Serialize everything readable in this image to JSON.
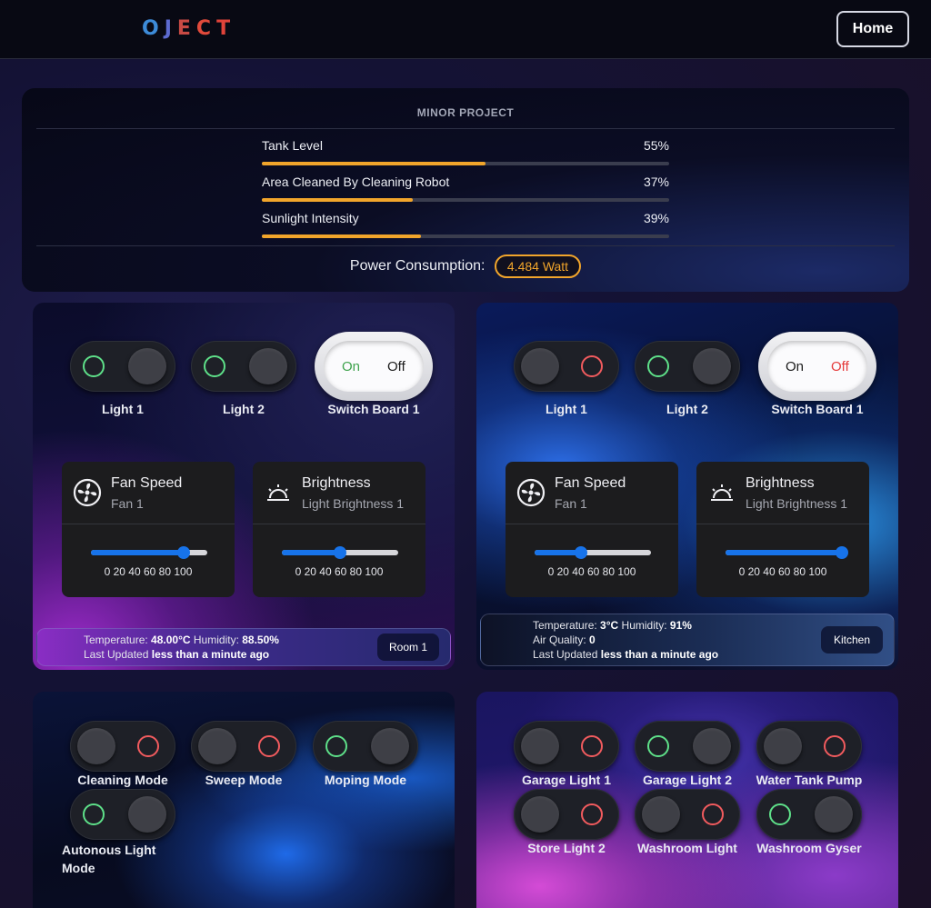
{
  "nav": {
    "brand_letters": [
      "O",
      "J",
      "E",
      "C",
      "T"
    ],
    "home_label": "Home"
  },
  "summary": {
    "title": "MINOR PROJECT",
    "metrics": [
      {
        "label": "Tank Level",
        "value_text": "55%",
        "value": 55
      },
      {
        "label": "Area Cleaned By Cleaning Robot",
        "value_text": "37%",
        "value": 37
      },
      {
        "label": "Sunlight Intensity",
        "value_text": "39%",
        "value": 39
      }
    ],
    "power_label": "Power Consumption:",
    "power_value": "4.484 Watt"
  },
  "room1": {
    "toggles": [
      {
        "label": "Light 1",
        "state": "on"
      },
      {
        "label": "Light 2",
        "state": "on"
      }
    ],
    "switchboard": {
      "label": "Switch Board 1",
      "on_label": "On",
      "off_label": "Off",
      "state": "on"
    },
    "fan": {
      "title": "Fan Speed",
      "subtitle": "Fan 1",
      "value": 80,
      "ticks": "0 20 40 60 80 100"
    },
    "brightness": {
      "title": "Brightness",
      "subtitle": "Light Brightness 1",
      "value": 50,
      "ticks": "0 20 40 60 80 100"
    },
    "info": {
      "temp_label": "Temperature:",
      "temp_value": "48.00°C",
      "hum_label": "Humidity:",
      "hum_value": "88.50%",
      "updated_label": "Last Updated",
      "updated_value": "less than a minute ago"
    },
    "room_name": "Room 1"
  },
  "room2": {
    "toggles": [
      {
        "label": "Light 1",
        "state": "off"
      },
      {
        "label": "Light 2",
        "state": "on"
      }
    ],
    "switchboard": {
      "label": "Switch Board 1",
      "on_label": "On",
      "off_label": "Off",
      "state": "off"
    },
    "fan": {
      "title": "Fan Speed",
      "subtitle": "Fan 1",
      "value": 40,
      "ticks": "0 20 40 60 80 100"
    },
    "brightness": {
      "title": "Brightness",
      "subtitle": "Light Brightness 1",
      "value": 100,
      "ticks": "0 20 40 60 80 100"
    },
    "info": {
      "temp_label": "Temperature:",
      "temp_value": "3°C",
      "hum_label": "Humidity:",
      "hum_value": "91%",
      "air_label": "Air Quality:",
      "air_value": "0",
      "updated_label": "Last Updated",
      "updated_value": "less than a minute ago"
    },
    "room_name": "Kitchen"
  },
  "room3": {
    "toggles": [
      {
        "label": "Cleaning Mode",
        "state": "off"
      },
      {
        "label": "Sweep Mode",
        "state": "off"
      },
      {
        "label": "Moping Mode",
        "state": "on"
      },
      {
        "label": "Autonous Light Mode",
        "state": "on"
      }
    ]
  },
  "room4": {
    "toggles": [
      {
        "label": "Garage Light 1",
        "state": "off"
      },
      {
        "label": "Garage Light 2",
        "state": "on"
      },
      {
        "label": "Water Tank Pump",
        "state": "off"
      },
      {
        "label": "Store Light 2",
        "state": "off"
      },
      {
        "label": "Washroom Light",
        "state": "off"
      },
      {
        "label": "Washroom Gyser",
        "state": "on"
      }
    ]
  },
  "colors": {
    "accent_orange": "#f1a52b",
    "slider_blue": "#1773ea",
    "on_green": "#5ee089",
    "off_red": "#f25b5e"
  },
  "icons": {
    "fan": "fan-icon",
    "brightness": "brightness-icon"
  }
}
